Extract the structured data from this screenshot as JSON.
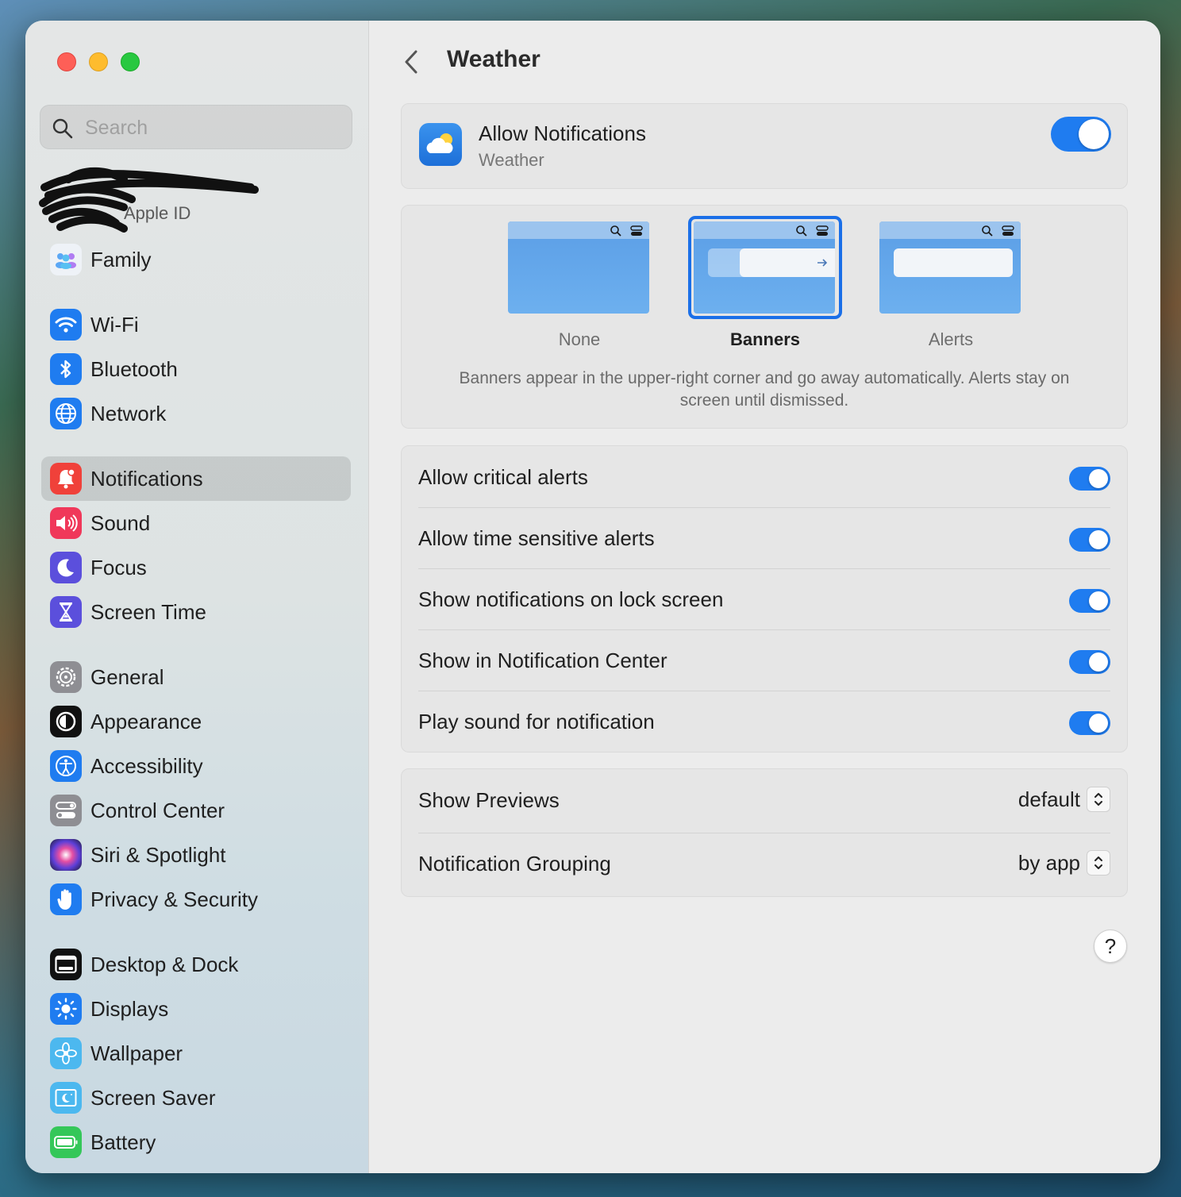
{
  "sidebar": {
    "search_placeholder": "Search",
    "apple_id_label": "Apple ID",
    "items": [
      {
        "label": "Family",
        "icon": "family-icon"
      },
      {
        "label": "Wi-Fi",
        "icon": "wifi-icon"
      },
      {
        "label": "Bluetooth",
        "icon": "bluetooth-icon"
      },
      {
        "label": "Network",
        "icon": "globe-icon"
      },
      {
        "label": "Notifications",
        "icon": "bell-icon"
      },
      {
        "label": "Sound",
        "icon": "speaker-icon"
      },
      {
        "label": "Focus",
        "icon": "moon-icon"
      },
      {
        "label": "Screen Time",
        "icon": "hourglass-icon"
      },
      {
        "label": "General",
        "icon": "gear-icon"
      },
      {
        "label": "Appearance",
        "icon": "appearance-icon"
      },
      {
        "label": "Accessibility",
        "icon": "accessibility-icon"
      },
      {
        "label": "Control Center",
        "icon": "control-center-icon"
      },
      {
        "label": "Siri & Spotlight",
        "icon": "siri-icon"
      },
      {
        "label": "Privacy & Security",
        "icon": "hand-icon"
      },
      {
        "label": "Desktop & Dock",
        "icon": "dock-icon"
      },
      {
        "label": "Displays",
        "icon": "sun-icon"
      },
      {
        "label": "Wallpaper",
        "icon": "flower-icon"
      },
      {
        "label": "Screen Saver",
        "icon": "screen-saver-icon"
      },
      {
        "label": "Battery",
        "icon": "battery-icon"
      }
    ],
    "active": "Notifications"
  },
  "header": {
    "title": "Weather"
  },
  "allow_notifications": {
    "title": "Allow Notifications",
    "subtitle": "Weather",
    "enabled": true
  },
  "alert_style": {
    "options": [
      "None",
      "Banners",
      "Alerts"
    ],
    "selected": "Banners",
    "description": "Banners appear in the upper-right corner and go away automatically. Alerts stay on screen until dismissed."
  },
  "toggles": [
    {
      "label": "Allow critical alerts",
      "on": true
    },
    {
      "label": "Allow time sensitive alerts",
      "on": true
    },
    {
      "label": "Show notifications on lock screen",
      "on": true
    },
    {
      "label": "Show in Notification Center",
      "on": true
    },
    {
      "label": "Play sound for notification",
      "on": true
    }
  ],
  "popups": [
    {
      "label": "Show Previews",
      "value": "default"
    },
    {
      "label": "Notification Grouping",
      "value": "by app"
    }
  ],
  "help_label": "?",
  "colors": {
    "accent": "#1f7cf0",
    "active_row": "#c9c9c9"
  }
}
